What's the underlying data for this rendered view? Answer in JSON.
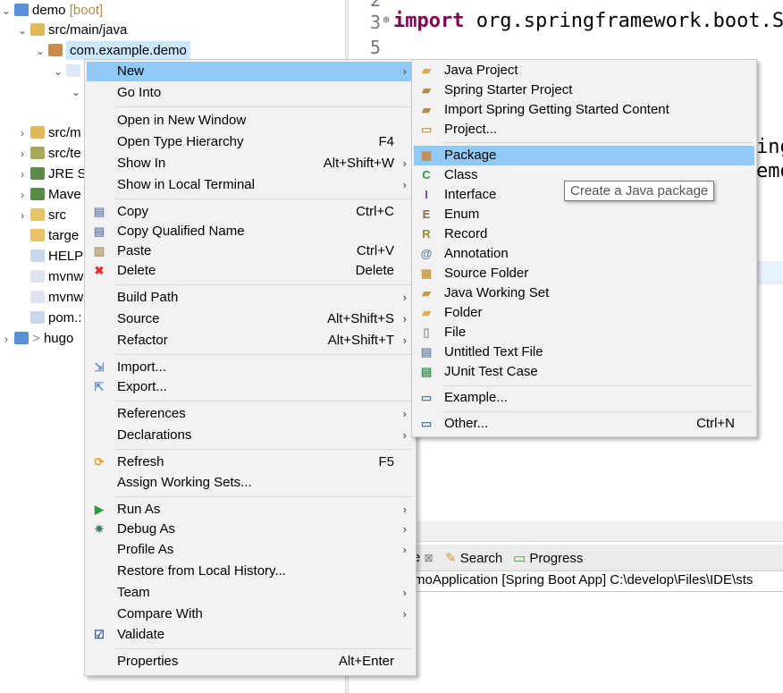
{
  "explorer": {
    "items": [
      {
        "label": "demo",
        "suffix": " [boot]",
        "icon": "project-icon",
        "chev": "v",
        "color": "#5b8fd6"
      },
      {
        "label": "src/main/java",
        "icon": "source-folder-icon",
        "chev": "v",
        "color": "#e2b95a"
      },
      {
        "label": "com.example.demo",
        "icon": "package-icon",
        "chev": "v",
        "color": "#c98a4a",
        "selected": true
      },
      {
        "label": "",
        "icon": "java-file-icon",
        "chev": "v",
        "color": "#dfe8f5"
      },
      {
        "label": "",
        "icon": "",
        "chev": "v",
        "color": ""
      },
      {
        "label": "src/m",
        "icon": "source-folder-icon",
        "chev": ">",
        "color": "#e2b95a"
      },
      {
        "label": "src/te",
        "icon": "source-folder-icon",
        "chev": ">",
        "color": "#a6a85a"
      },
      {
        "label": "JRE S",
        "icon": "library-icon",
        "chev": ">",
        "color": "#5a8a4a"
      },
      {
        "label": "Mave",
        "icon": "library-icon",
        "chev": ">",
        "color": "#5a8a4a"
      },
      {
        "label": "src",
        "icon": "folder-icon",
        "chev": ">",
        "color": "#e8c36a"
      },
      {
        "label": "targe",
        "icon": "folder-icon",
        "chev": "",
        "color": "#e8c36a"
      },
      {
        "label": "HELP",
        "icon": "word-file-icon",
        "chev": "",
        "color": "#c9d6ea"
      },
      {
        "label": "mvnw",
        "icon": "text-file-icon",
        "chev": "",
        "color": "#dfe4ee"
      },
      {
        "label": "mvnw",
        "icon": "text-file-icon",
        "chev": "",
        "color": "#dfe4ee"
      },
      {
        "label": "pom.:",
        "icon": "maven-file-icon",
        "chev": "",
        "color": "#c9d6ea"
      },
      {
        "label": "hugo",
        "prefix": "> ",
        "icon": "project-icon",
        "chev": ">",
        "color": "#5b8fd6"
      }
    ]
  },
  "editor": {
    "line_numbers": [
      "2",
      "3",
      "5"
    ],
    "code_keyword": "import",
    "code_line": " org.springframework.boot.Sp",
    "fragment1": "ing",
    "fragment2": "emo"
  },
  "context_menu": {
    "items": [
      {
        "label": "New",
        "arrow": true,
        "highlight": true
      },
      {
        "label": "Go Into"
      },
      {
        "sep": true
      },
      {
        "label": "Open in New Window"
      },
      {
        "label": "Open Type Hierarchy",
        "shortcut": "F4"
      },
      {
        "label": "Show In",
        "shortcut": "Alt+Shift+W",
        "arrow": true
      },
      {
        "label": "Show in Local Terminal",
        "arrow": true
      },
      {
        "sep": true
      },
      {
        "label": "Copy",
        "shortcut": "Ctrl+C",
        "icon": "copy-icon"
      },
      {
        "label": "Copy Qualified Name",
        "icon": "copy-qualified-icon"
      },
      {
        "label": "Paste",
        "shortcut": "Ctrl+V",
        "icon": "paste-icon"
      },
      {
        "label": "Delete",
        "shortcut": "Delete",
        "icon": "delete-icon"
      },
      {
        "sep": true
      },
      {
        "label": "Build Path",
        "arrow": true
      },
      {
        "label": "Source",
        "shortcut": "Alt+Shift+S",
        "arrow": true
      },
      {
        "label": "Refactor",
        "shortcut": "Alt+Shift+T",
        "arrow": true
      },
      {
        "sep": true
      },
      {
        "label": "Import...",
        "icon": "import-icon"
      },
      {
        "label": "Export...",
        "icon": "export-icon"
      },
      {
        "sep": true
      },
      {
        "label": "References",
        "arrow": true
      },
      {
        "label": "Declarations",
        "arrow": true
      },
      {
        "sep": true
      },
      {
        "label": "Refresh",
        "shortcut": "F5",
        "icon": "refresh-icon"
      },
      {
        "label": "Assign Working Sets..."
      },
      {
        "sep": true
      },
      {
        "label": "Run As",
        "arrow": true,
        "icon": "run-icon"
      },
      {
        "label": "Debug As",
        "arrow": true,
        "icon": "debug-icon"
      },
      {
        "label": "Profile As",
        "arrow": true
      },
      {
        "label": "Restore from Local History..."
      },
      {
        "label": "Team",
        "arrow": true
      },
      {
        "label": "Compare With",
        "arrow": true
      },
      {
        "label": "Validate",
        "icon": "checkbox-icon"
      },
      {
        "sep": true
      },
      {
        "label": "Properties",
        "shortcut": "Alt+Enter"
      }
    ]
  },
  "new_submenu": {
    "items": [
      {
        "label": "Java Project",
        "icon": "java-project-icon"
      },
      {
        "label": "Spring Starter Project",
        "icon": "spring-project-icon"
      },
      {
        "label": "Import Spring Getting Started Content",
        "icon": "spring-import-icon"
      },
      {
        "label": "Project...",
        "icon": "new-project-icon"
      },
      {
        "sep": true
      },
      {
        "label": "Package",
        "icon": "package-icon",
        "highlight": true
      },
      {
        "label": "Class",
        "icon": "class-icon"
      },
      {
        "label": "Interface",
        "icon": "interface-icon"
      },
      {
        "label": "Enum",
        "icon": "enum-icon"
      },
      {
        "label": "Record",
        "icon": "record-icon"
      },
      {
        "label": "Annotation",
        "icon": "annotation-icon"
      },
      {
        "label": "Source Folder",
        "icon": "source-folder-icon"
      },
      {
        "label": "Java Working Set",
        "icon": "working-set-icon"
      },
      {
        "label": "Folder",
        "icon": "folder-icon"
      },
      {
        "label": "File",
        "icon": "file-icon"
      },
      {
        "label": "Untitled Text File",
        "icon": "text-file-icon"
      },
      {
        "label": "JUnit Test Case",
        "icon": "junit-icon"
      },
      {
        "sep": true
      },
      {
        "label": "Example...",
        "icon": "example-icon"
      },
      {
        "sep": true
      },
      {
        "label": "Other...",
        "icon": "wizard-icon",
        "shortcut": "Ctrl+N"
      }
    ]
  },
  "tooltip": "Create a Java package",
  "bottom_panel": {
    "tab_partial": "e",
    "tab_close": "⊠",
    "tabs": [
      "Search",
      "Progress"
    ],
    "console_line": "moApplication [Spring Boot App] C:\\develop\\Files\\IDE\\sts"
  },
  "colors": {
    "highlight": "#91c9f7",
    "selection": "#cce8ff",
    "menu_bg": "#f2f2f2",
    "keyword": "#7f0055"
  }
}
